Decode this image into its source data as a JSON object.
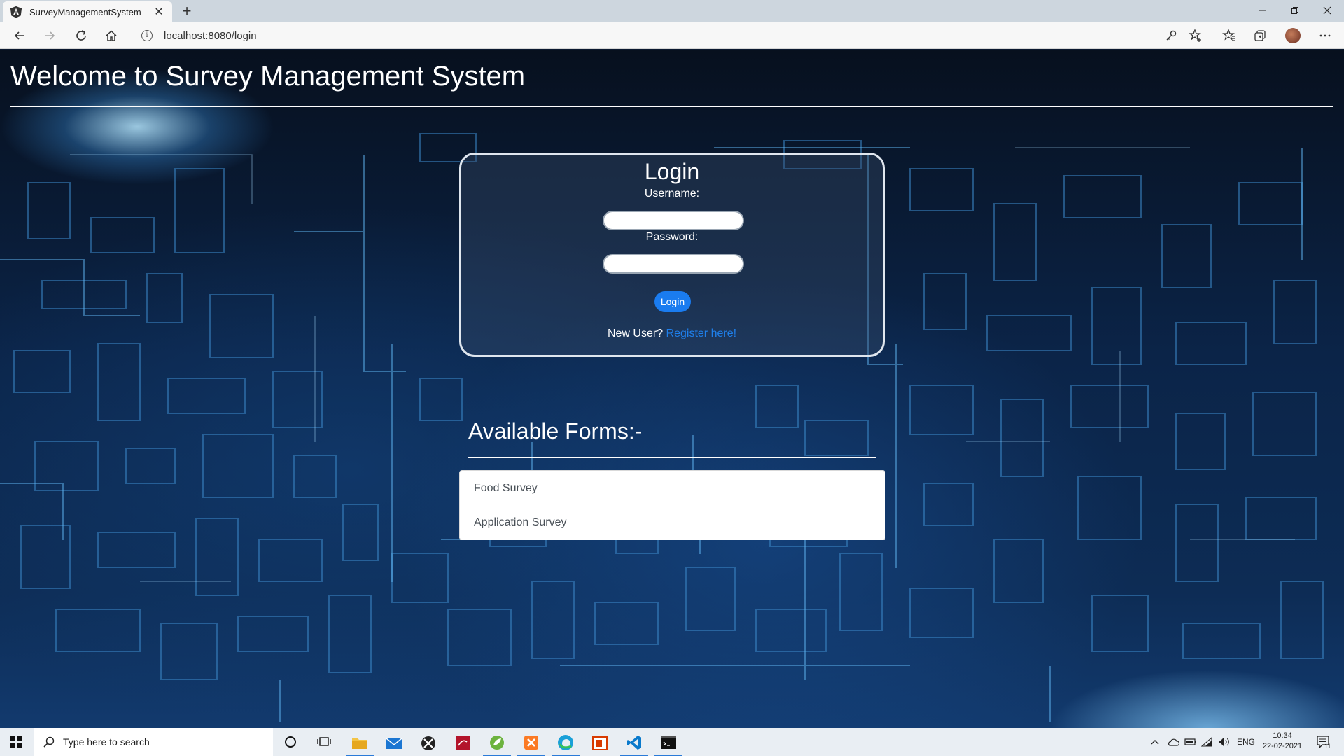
{
  "browser": {
    "tab_title": "SurveyManagementSystem",
    "url": "localhost:8080/login"
  },
  "page": {
    "welcome": "Welcome to Survey Management System",
    "login": {
      "title": "Login",
      "username_label": "Username:",
      "username_value": "",
      "password_label": "Password:",
      "password_value": "",
      "button": "Login",
      "new_user_text": "New User?",
      "register_link": "Register here!"
    },
    "forms": {
      "title": "Available Forms:-",
      "items": [
        "Food Survey",
        "Application Survey"
      ]
    }
  },
  "taskbar": {
    "search_placeholder": "Type here to search",
    "language": "ENG",
    "time": "10:34",
    "date": "22-02-2021",
    "notification_count": "11"
  },
  "colors": {
    "accent": "#1a7cf0",
    "link": "#1f7fea"
  }
}
